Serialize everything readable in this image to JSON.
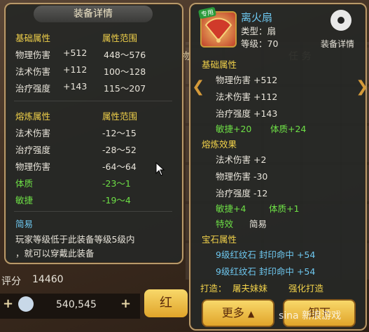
{
  "left": {
    "title": "装备详情",
    "base_header": "基础属性",
    "range_header": "属性范围",
    "base_stats": [
      {
        "name": "物理伤害",
        "value": "+512",
        "range": "448～576"
      },
      {
        "name": "法术伤害",
        "value": "+112",
        "range": "100～128"
      },
      {
        "name": "治疗强度",
        "value": "+143",
        "range": "115～207"
      }
    ],
    "refine_header": "熔炼属性",
    "refine_range_header": "属性范围",
    "refine_stats": [
      {
        "name": "法术伤害",
        "range": "-12～15"
      },
      {
        "name": "治疗强度",
        "range": "-28～52"
      },
      {
        "name": "物理伤害",
        "range": "-64～64"
      },
      {
        "name": "体质",
        "range": "-23～1"
      },
      {
        "name": "敏捷",
        "range": "-19～4"
      }
    ],
    "desc_title": "简易",
    "desc_line1": "玩家等级低于此装备等级5级内",
    "desc_line2": "，就可以穿戴此装备"
  },
  "right": {
    "item_badge": "专用",
    "item_name": "离火扇",
    "item_type": "类型：扇",
    "item_level": "等级：70",
    "details_label": "装备详情",
    "base_header": "基础属性",
    "base_stats": [
      "物理伤害 +512",
      "法术伤害 +112",
      "治疗强度 +143"
    ],
    "bonus_line": {
      "a": "敏捷+20",
      "b": "体质+24"
    },
    "refine_header": "熔炼效果",
    "refine_stats": [
      "法术伤害 +2",
      "物理伤害 -30",
      "治疗强度 -12"
    ],
    "refine_bonus": {
      "a": "敏捷+4",
      "b": "体质+1"
    },
    "special": {
      "a": "特效",
      "b": "简易"
    },
    "gem_header": "宝石属性",
    "gems": [
      "9级红纹石 封印命中 +54",
      "9级红纹石 封印命中 +54"
    ],
    "craft_label": "打造：",
    "craft_by": "屠夫妹妹",
    "craft_mode": "强化打造",
    "more_button": "更多",
    "unequip_button": "卸下"
  },
  "background": {
    "score_label": "评分",
    "score_value": "14460",
    "gold_value": "540,545",
    "behind_button": "红",
    "behind_text_a": "物",
    "behind_text_b": "任 务"
  },
  "watermark": "sina 新浪游戏",
  "colors": {
    "yellow": "#f2d24a",
    "green": "#6ee046",
    "blue": "#6ec8f0",
    "frame": "#b89a6a"
  }
}
